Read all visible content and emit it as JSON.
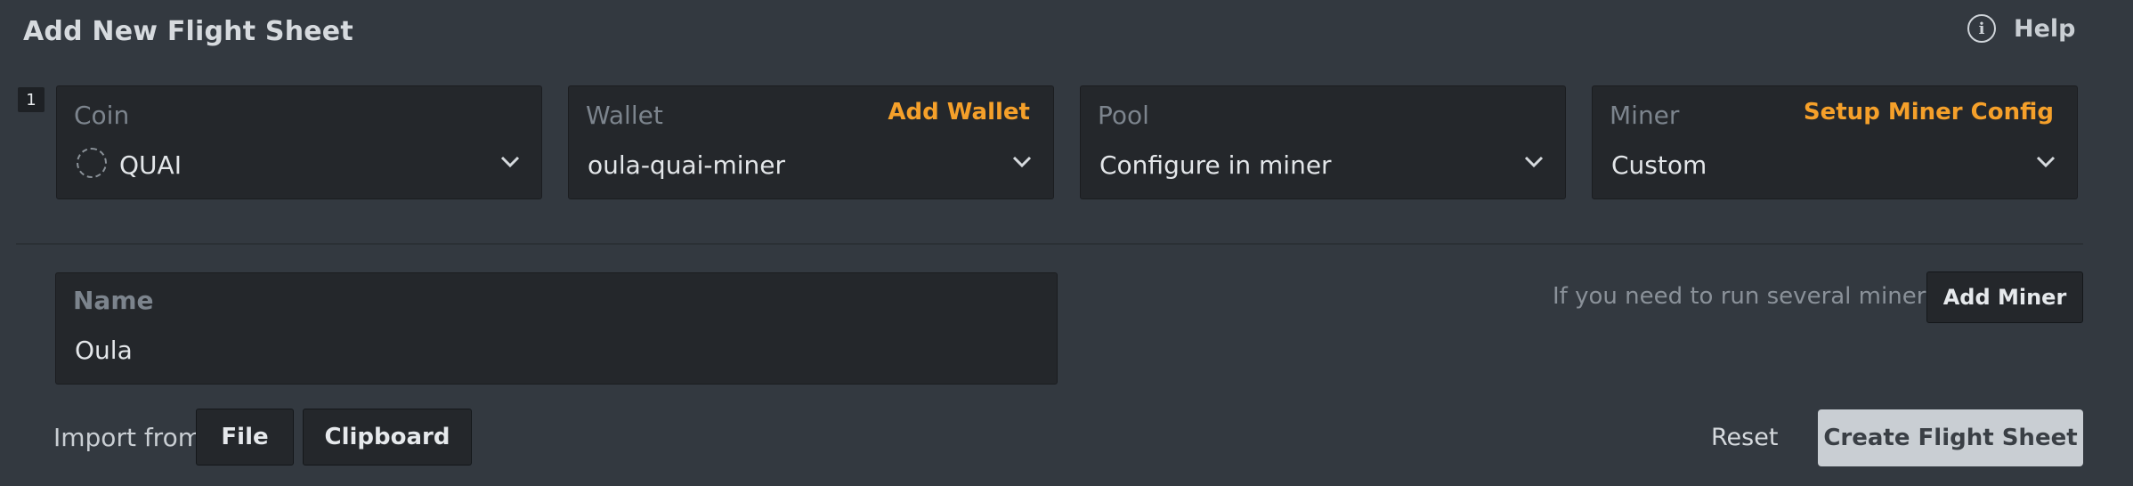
{
  "header": {
    "title": "Add New Flight Sheet",
    "help_label": "Help",
    "help_icon": "info-icon"
  },
  "row_index": "1",
  "cards": {
    "coin": {
      "label": "Coin",
      "value": "QUAI",
      "icon": "coin-placeholder-icon"
    },
    "wallet": {
      "label": "Wallet",
      "action": "Add Wallet",
      "value": "oula-quai-miner"
    },
    "pool": {
      "label": "Pool",
      "value": "Configure in miner"
    },
    "miner": {
      "label": "Miner",
      "action": "Setup Miner Config",
      "value": "Custom"
    }
  },
  "name": {
    "label": "Name",
    "value": "Oula"
  },
  "miner_hint": "If you need to run several miners",
  "buttons": {
    "add_miner": "Add Miner",
    "import_label": "Import from",
    "file": "File",
    "clipboard": "Clipboard",
    "reset": "Reset",
    "create": "Create Flight Sheet"
  },
  "colors": {
    "background": "#333940",
    "card_bg": "#24272b",
    "accent_orange": "#f5a02a",
    "primary_button": "#c9ced3"
  }
}
